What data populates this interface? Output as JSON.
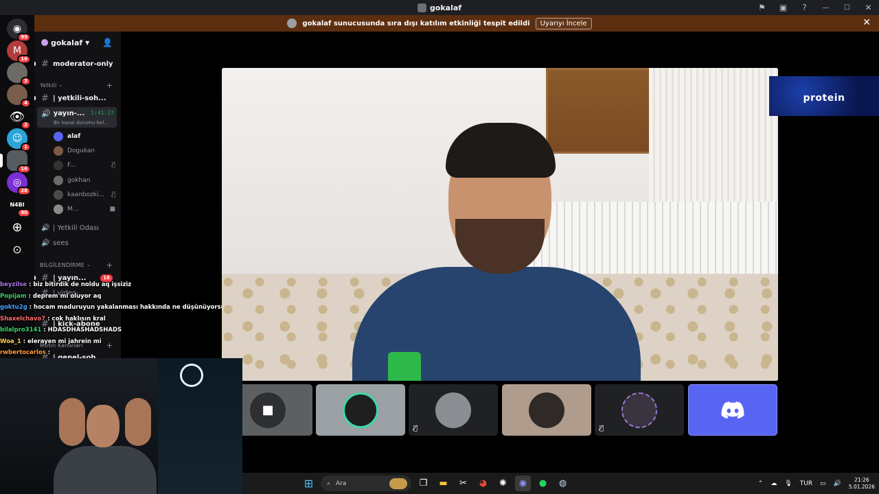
{
  "window": {
    "title": "gokalaf"
  },
  "banner": {
    "text": "gokalaf sunucusunda sıra dışı katılım etkinliği tespit edildi",
    "button": "Uyarıyı İncele"
  },
  "guilds": [
    {
      "icon": "discord-home-icon",
      "badge": "99"
    },
    {
      "icon": "server-m-icon",
      "badge": "16"
    },
    {
      "icon": "server-avatar-icon",
      "badge": "3"
    },
    {
      "icon": "server-avatar-icon",
      "badge": "4"
    },
    {
      "icon": "eye-icon",
      "badge": "2"
    },
    {
      "icon": "smiley-icon",
      "badge": "1"
    },
    {
      "icon": "server-avatar-icon",
      "badge": "16"
    },
    {
      "icon": "signal-icon",
      "badge": "28"
    },
    {
      "icon": "server-nabi-icon",
      "badge": "90"
    },
    {
      "icon": "add-server-icon",
      "badge": ""
    },
    {
      "icon": "explore-icon",
      "badge": ""
    }
  ],
  "server": {
    "name": "gokalaf"
  },
  "channels": {
    "moderator": "moderator-only",
    "cat1": "Yetkili",
    "yetkili_sohbet": "| yetkili-soh...",
    "voice_active": "yayın-...",
    "voice_timer": "1:41:27",
    "voice_status": "Bir kanal durumu bel...",
    "users": [
      "alaf",
      "Dogukan",
      "F...",
      "gokhan",
      "kaanbozki...",
      "M..."
    ],
    "yetkili_odasi": "| Yetkili Odası",
    "sees": "sees",
    "cat2": "BİLGİLENDİRME",
    "yayin": "| yayın...",
    "yayin_badge": "16",
    "video": "| video-...",
    "kick": "| kick-abone",
    "cat3": "Metin Kanalları",
    "genel": "| genel-soh..."
  },
  "chat": [
    {
      "user": "beyzilse",
      "color": "#a678e0",
      "msg": "biz bitirdik de noldu aq işsiziz"
    },
    {
      "user": "Popijam",
      "color": "#3cd16a",
      "msg": "deprem mi oluyor aq"
    },
    {
      "user": "goktu2g",
      "color": "#4aa0ff",
      "msg": "hocam maduruyun yakalanması hakkında ne düşünüyorsun"
    },
    {
      "user": "Shaxelchavo7",
      "color": "#ff6d6d",
      "msg": "cok haklısın kral"
    },
    {
      "user": "bilalpro3141",
      "color": "#3cd16a",
      "msg": "HDASDHASHADSHADS"
    },
    {
      "user": "Woa_1",
      "color": "#ffd34a",
      "msg": "elerayen mi jahrein mi"
    },
    {
      "user": "rwbertocarlos",
      "color": "#ff9a3c",
      "msg": ""
    }
  ],
  "overlay": {
    "brand": "protein"
  },
  "taskbar": {
    "search": "Ara",
    "lang": "TUR",
    "time": "21:26",
    "date": "5.01.2026"
  },
  "colors": {
    "accent": "#5865f2",
    "online": "#23a559",
    "badge": "#f23f43",
    "banner": "#5c2e10"
  }
}
